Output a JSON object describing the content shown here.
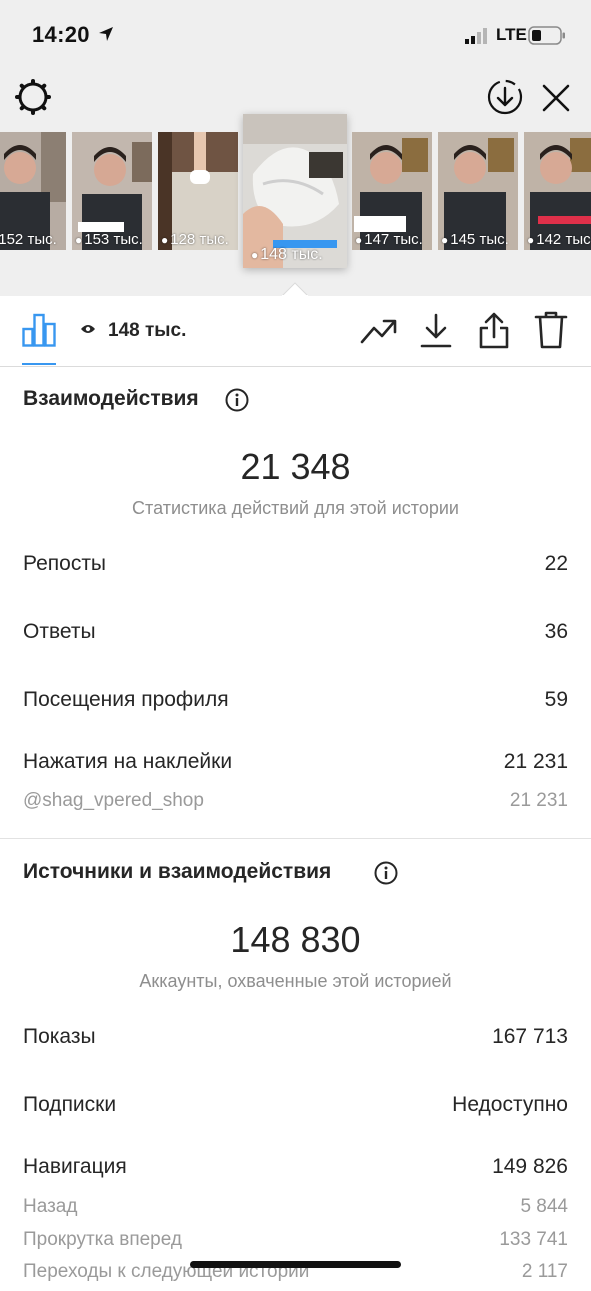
{
  "status_bar": {
    "time": "14:20",
    "network": "LTE"
  },
  "stories": [
    {
      "views": "152 тыс.",
      "selected": false
    },
    {
      "views": "153 тыс.",
      "selected": false
    },
    {
      "views": "128 тыс.",
      "selected": false
    },
    {
      "views": "148 тыс.",
      "selected": true
    },
    {
      "views": "147 тыс.",
      "selected": false
    },
    {
      "views": "145 тыс.",
      "selected": false
    },
    {
      "views": "142 тыс.",
      "selected": false
    }
  ],
  "toolbar": {
    "views_total": "148 тыс.",
    "active_tab": "stats"
  },
  "interactions": {
    "title": "Взаимодействия",
    "total": "21 348",
    "subtitle": "Статистика действий для этой истории",
    "rows": [
      {
        "label": "Репосты",
        "value": "22"
      },
      {
        "label": "Ответы",
        "value": "36"
      },
      {
        "label": "Посещения профиля",
        "value": "59"
      },
      {
        "label": "Нажатия на наклейки",
        "value": "21 231"
      }
    ],
    "sticker_rows": [
      {
        "label": "@shag_vpered_shop",
        "value": "21 231"
      }
    ]
  },
  "discovery": {
    "title": "Источники и взаимодействия",
    "total": "148 830",
    "subtitle": "Аккаунты, охваченные этой историей",
    "rows": [
      {
        "label": "Показы",
        "value": "167 713"
      },
      {
        "label": "Подписки",
        "value": "Недоступно"
      },
      {
        "label": "Навигация",
        "value": "149 826"
      }
    ],
    "navigation_rows": [
      {
        "label": "Назад",
        "value": "5 844"
      },
      {
        "label": "Прокрутка вперед",
        "value": "133 741"
      },
      {
        "label": "Переходы к следующей истории",
        "value": "2 117"
      }
    ]
  },
  "colors": {
    "accent": "#3897f0",
    "header_bg": "#efefef",
    "muted": "#8e8e8e"
  },
  "icons": [
    "settings-icon",
    "download-circle-icon",
    "close-icon",
    "bar-chart-icon",
    "eye-icon",
    "trend-icon",
    "download-icon",
    "share-icon",
    "trash-icon",
    "info-icon"
  ]
}
